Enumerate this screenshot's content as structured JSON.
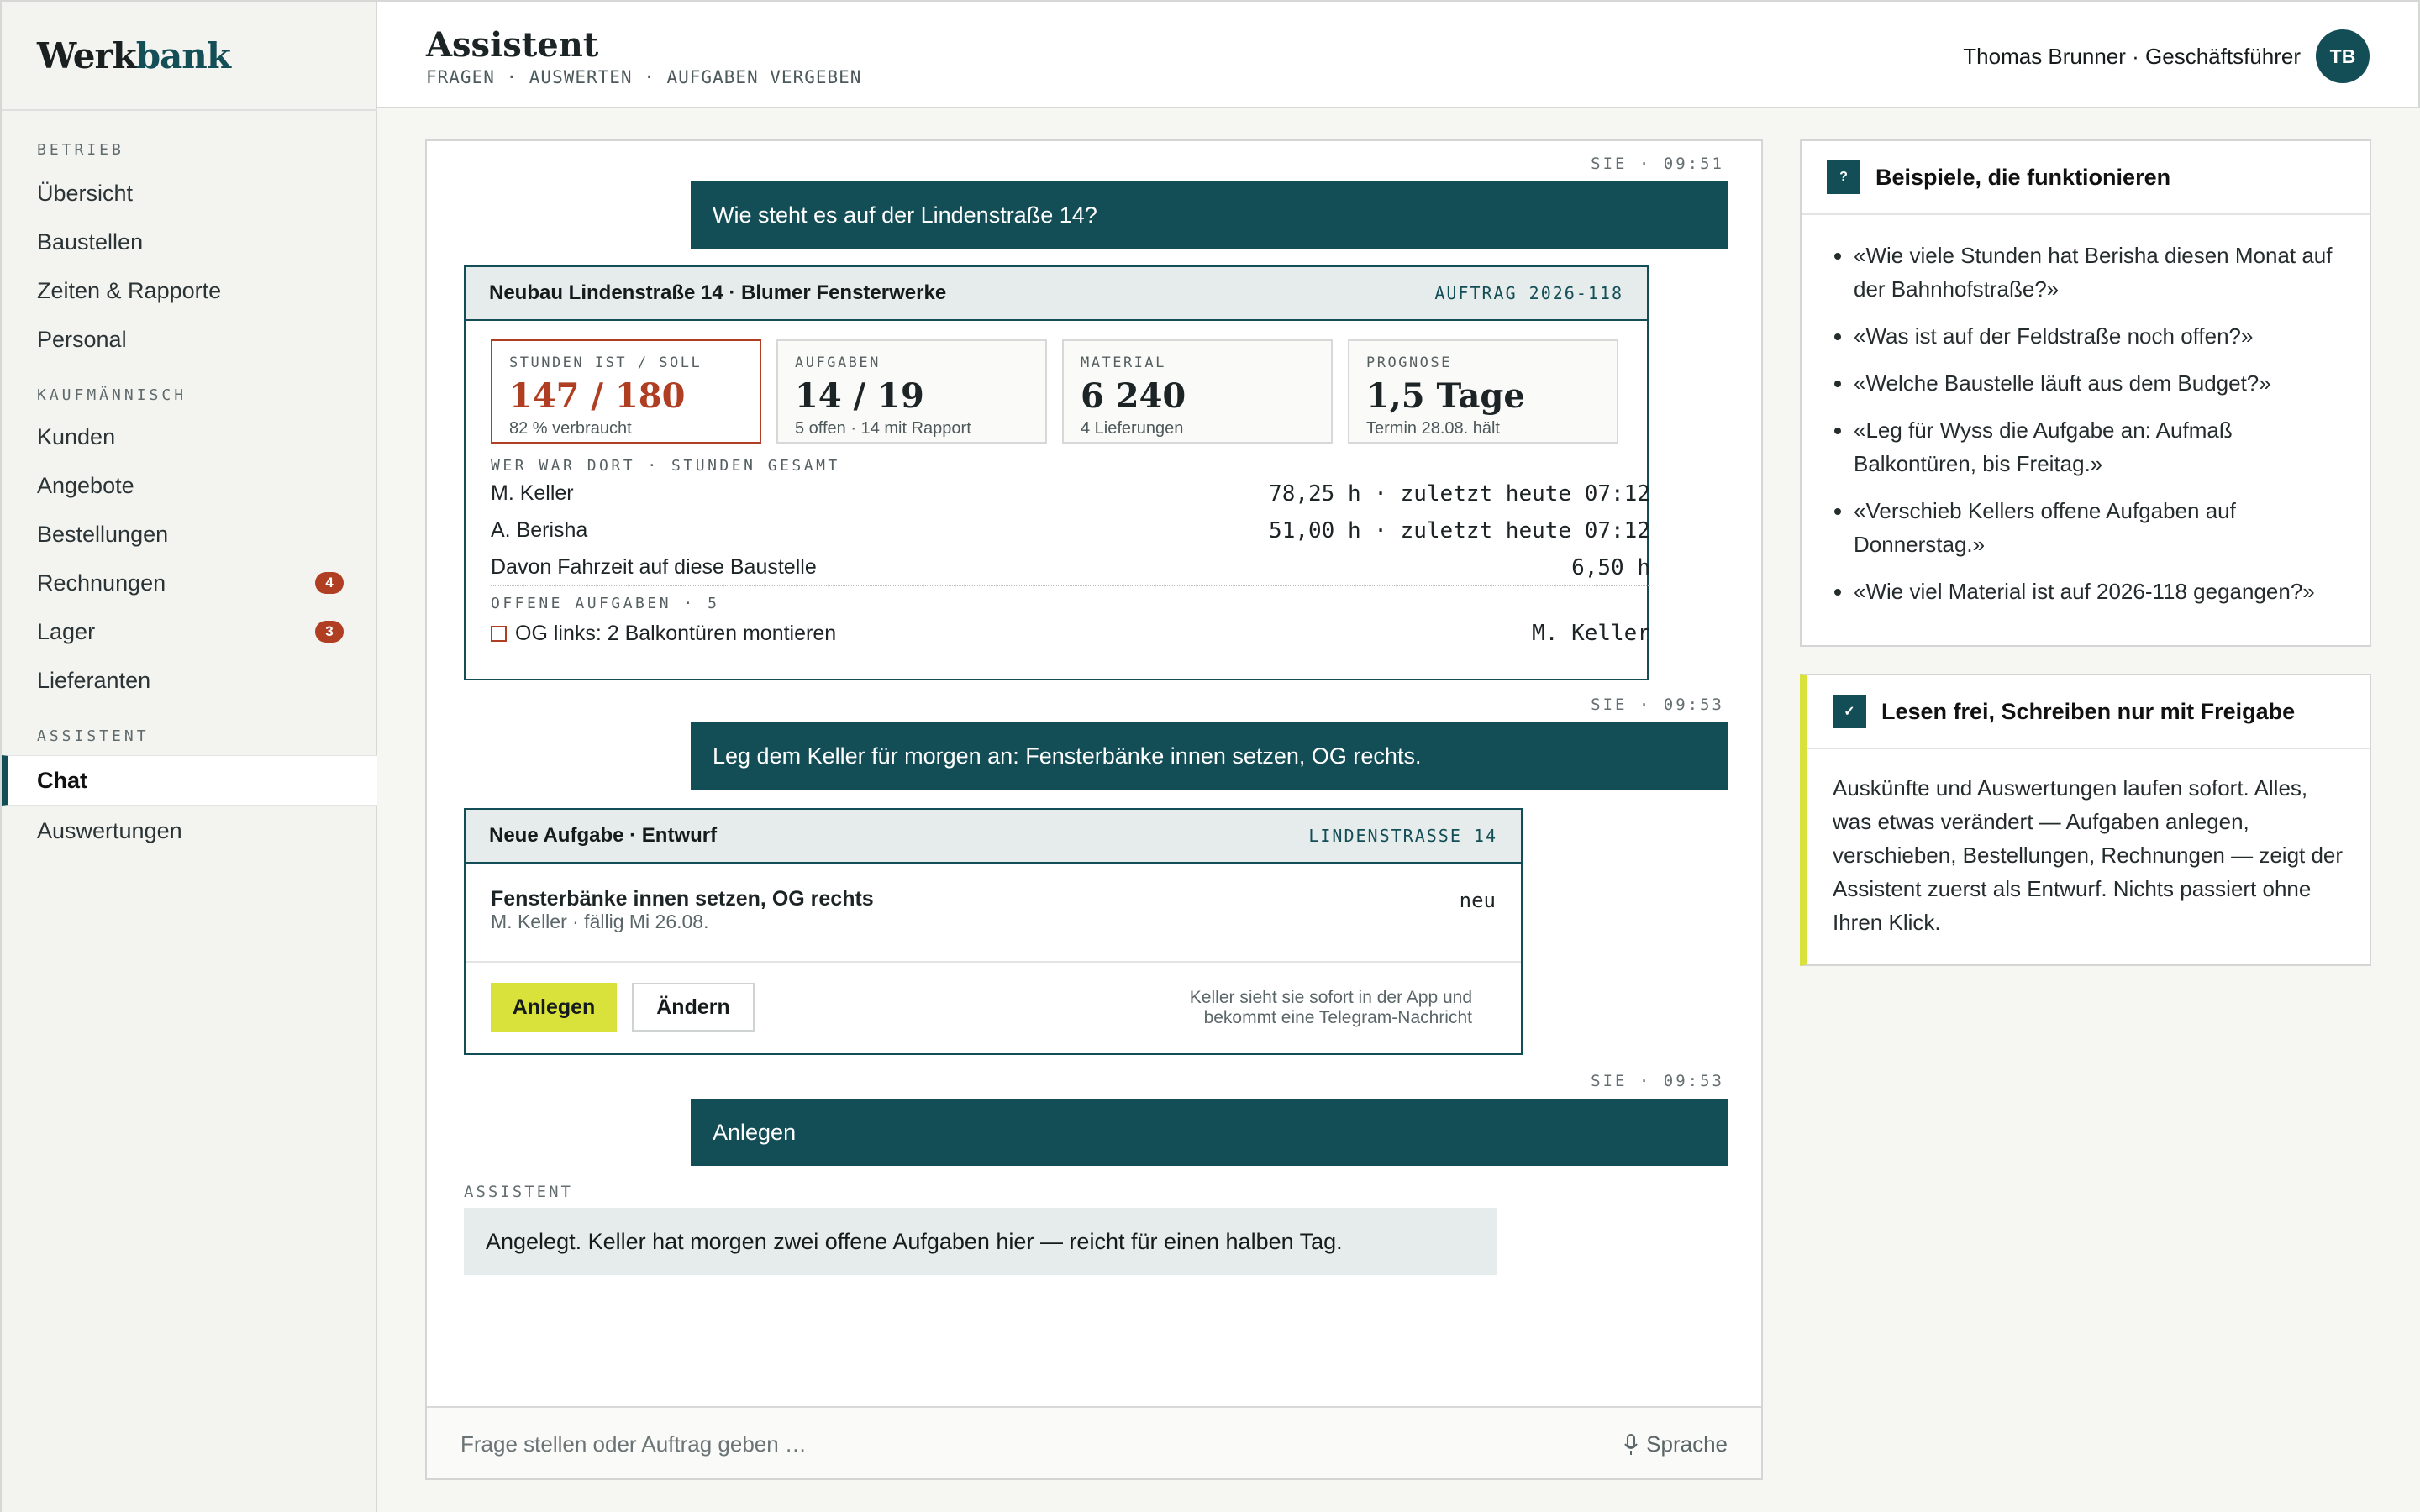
{
  "app": {
    "logo_part1": "Werk",
    "logo_part2": "bank"
  },
  "sidebar": {
    "sections": [
      {
        "label": "BETRIEB",
        "items": [
          {
            "label": "Übersicht"
          },
          {
            "label": "Baustellen"
          },
          {
            "label": "Zeiten & Rapporte"
          },
          {
            "label": "Personal"
          }
        ]
      },
      {
        "label": "KAUFMÄNNISCH",
        "items": [
          {
            "label": "Kunden"
          },
          {
            "label": "Angebote"
          },
          {
            "label": "Bestellungen"
          },
          {
            "label": "Rechnungen",
            "badge": "4"
          },
          {
            "label": "Lager",
            "badge": "3"
          },
          {
            "label": "Lieferanten"
          }
        ]
      },
      {
        "label": "ASSISTENT",
        "items": [
          {
            "label": "Chat",
            "active": true
          },
          {
            "label": "Auswertungen"
          }
        ]
      }
    ]
  },
  "header": {
    "title": "Assistent",
    "subtitle": "FRAGEN · AUSWERTEN · AUFGABEN VERGEBEN",
    "user": "Thomas Brunner · Geschäftsführer",
    "avatar": "TB"
  },
  "chat": {
    "msg1": {
      "stamp": "SIE · 09:51",
      "text": "Wie steht es auf der Lindenstraße 14?"
    },
    "site_card": {
      "title": "Neubau Lindenstraße 14 · Blumer Fensterwerke",
      "ref": "AUFTRAG 2026-118",
      "stats": [
        {
          "label": "STUNDEN IST / SOLL",
          "value": "147 / 180",
          "note": "82 % verbraucht"
        },
        {
          "label": "AUFGABEN",
          "value": "14 / 19",
          "note": "5 offen · 14 mit Rapport"
        },
        {
          "label": "MATERIAL",
          "value": "6 240",
          "note": "4 Lieferungen"
        },
        {
          "label": "PROGNOSE",
          "value": "1,5 Tage",
          "note": "Termin 28.08. hält"
        }
      ],
      "who_caption": "WER WAR DORT · STUNDEN GESAMT",
      "who": [
        {
          "name": "M. Keller",
          "value": "78,25 h · zuletzt heute 07:12"
        },
        {
          "name": "A. Berisha",
          "value": "51,00 h · zuletzt heute 07:12"
        },
        {
          "name": "Davon Fahrzeit auf diese Baustelle",
          "value": "6,50 h"
        }
      ],
      "open_caption": "OFFENE AUFGABEN · 5",
      "open_task": {
        "label": "OG links: 2 Balkontüren montieren",
        "assignee": "M. Keller"
      }
    },
    "msg2": {
      "stamp": "SIE · 09:53",
      "text": "Leg dem Keller für morgen an: Fensterbänke innen setzen, OG rechts."
    },
    "task_card": {
      "title": "Neue Aufgabe · Entwurf",
      "ref": "LINDENSTRASSE 14",
      "task_title": "Fensterbänke innen setzen, OG rechts",
      "task_meta": "M. Keller · fällig Mi 26.08.",
      "status": "neu",
      "btn_create": "Anlegen",
      "btn_edit": "Ändern",
      "hint_line1": "Keller sieht sie sofort in der App und",
      "hint_line2": "bekommt eine Telegram-Nachricht"
    },
    "msg3": {
      "stamp": "SIE · 09:53",
      "text": "Anlegen"
    },
    "assistant": {
      "label": "ASSISTENT",
      "text": "Angelegt. Keller hat morgen zwei offene Aufgaben hier — reicht für einen halben Tag."
    },
    "input": {
      "placeholder": "Frage stellen oder Auftrag geben …",
      "voice_label": "Sprache"
    }
  },
  "examples": {
    "icon": "?",
    "title": "Beispiele, die funktionieren",
    "items": [
      "«Wie viele Stunden hat Berisha diesen Monat auf der Bahnhofstraße?»",
      "«Was ist auf der Feldstraße noch offen?»",
      "«Welche Baustelle läuft aus dem Budget?»",
      "«Leg für Wyss die Aufgabe an: Aufmaß Balkontüren, bis Freitag.»",
      "«Verschieb Kellers offene Aufgaben auf Donnerstag.»",
      "«Wie viel Material ist auf 2026-118 gegangen?»"
    ]
  },
  "policy": {
    "icon": "✓",
    "title": "Lesen frei, Schreiben nur mit Freigabe",
    "text": "Auskünfte und Auswertungen laufen sofort. Alles, was etwas verändert — Aufgaben anlegen, verschieben, Bestellungen, Rechnungen — zeigt der Assistent zuerst als Entwurf. Nichts passiert ohne Ihren Klick."
  },
  "colors": {
    "brand": "#134e56",
    "accent": "#d9e23a",
    "alert": "#b03e22"
  }
}
